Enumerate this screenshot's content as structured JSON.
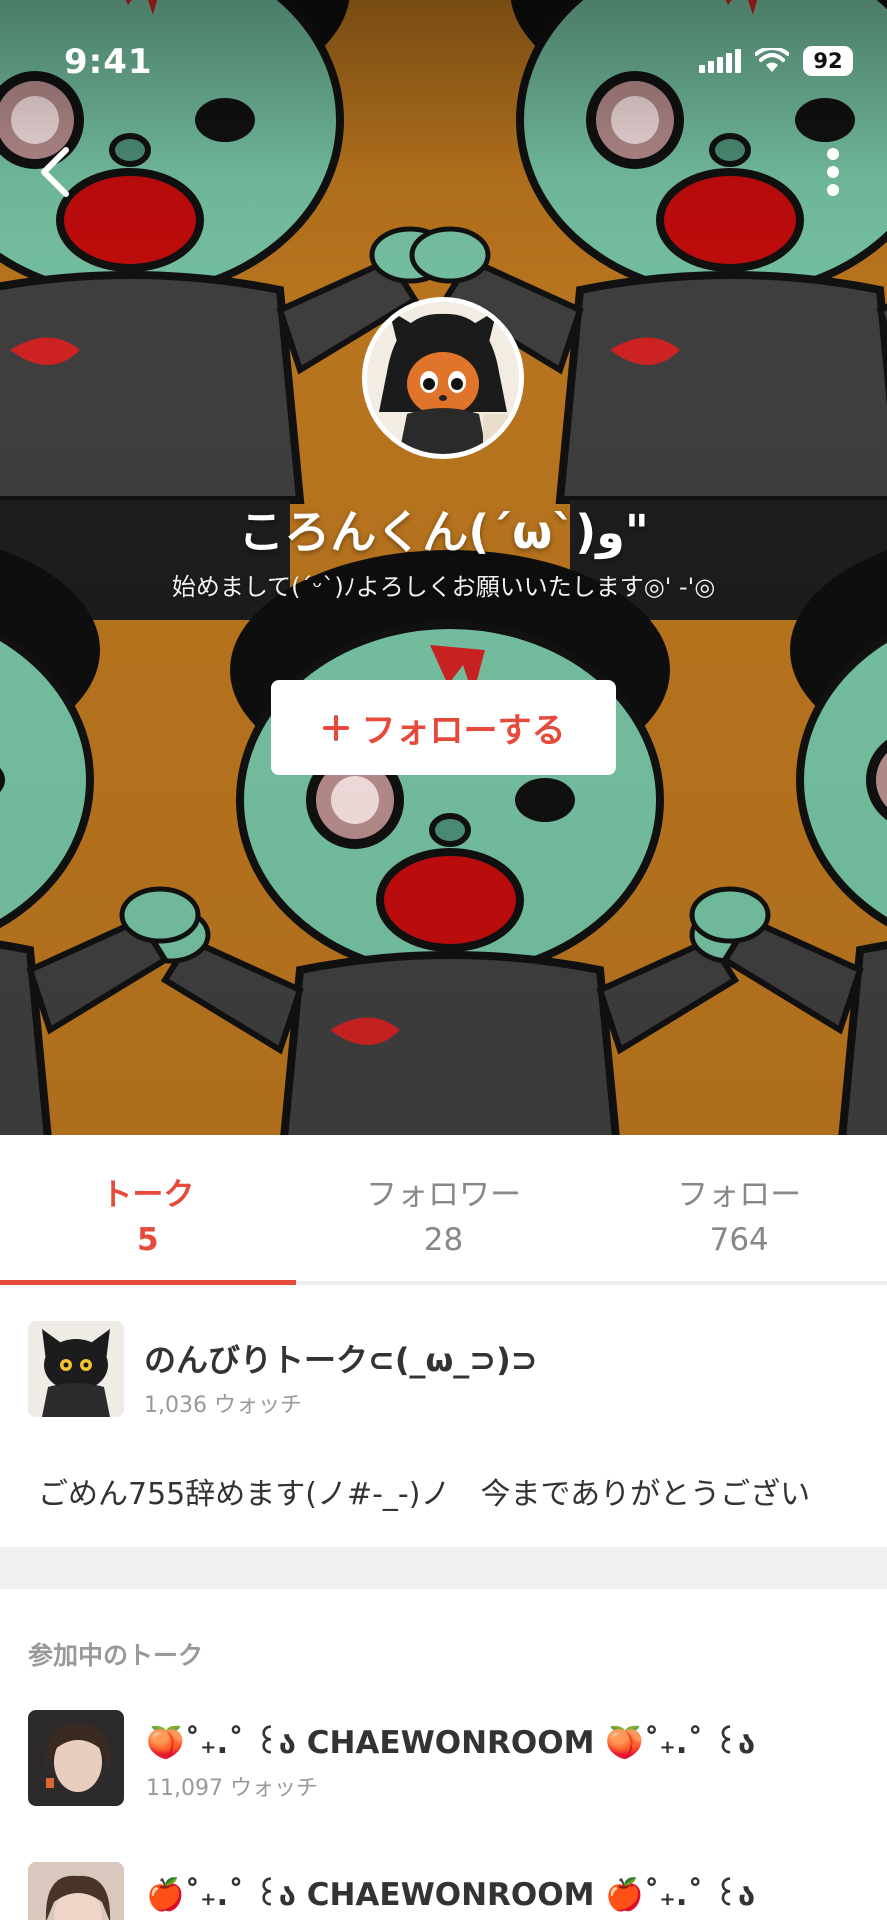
{
  "status_bar": {
    "time": "9:41",
    "battery": "92"
  },
  "profile": {
    "name": "ころんくん(ˊωˋ)و\"",
    "bio": "始めまして(ˊᵕˋ)ﾉよろしくお願いいたします◎' -'◎",
    "follow_label": "フォローする"
  },
  "tabs": [
    {
      "label": "トーク",
      "count": "5"
    },
    {
      "label": "フォロワー",
      "count": "28"
    },
    {
      "label": "フォロー",
      "count": "764"
    }
  ],
  "talk": {
    "title": "のんびりトーク⊂(_ω_⊃)⊃",
    "watch": "1,036 ウォッチ",
    "message": "ごめん755辞めます(ノ#-_-)ノ　今までありがとうござい"
  },
  "joined": {
    "header": "参加中のトーク",
    "items": [
      {
        "title": "🍑˚₊.˚ ꒰ა CHAEWONROOM 🍑˚₊.˚ ꒰ა",
        "watch": "11,097 ウォッチ"
      },
      {
        "title": "🍎˚₊.˚ ꒰ა CHAEWONROOM 🍎˚₊.˚ ꒰ა",
        "watch": ""
      }
    ]
  },
  "icons": {
    "back": "chevron-left-icon",
    "more": "more-vertical-icon",
    "plus": "plus-icon",
    "wifi": "wifi-icon",
    "signal": "signal-icon",
    "battery": "battery-icon"
  },
  "colors": {
    "accent": "#e64a3b",
    "hero_bg": "#b8741e",
    "zombie_skin": "#74bfa0"
  }
}
